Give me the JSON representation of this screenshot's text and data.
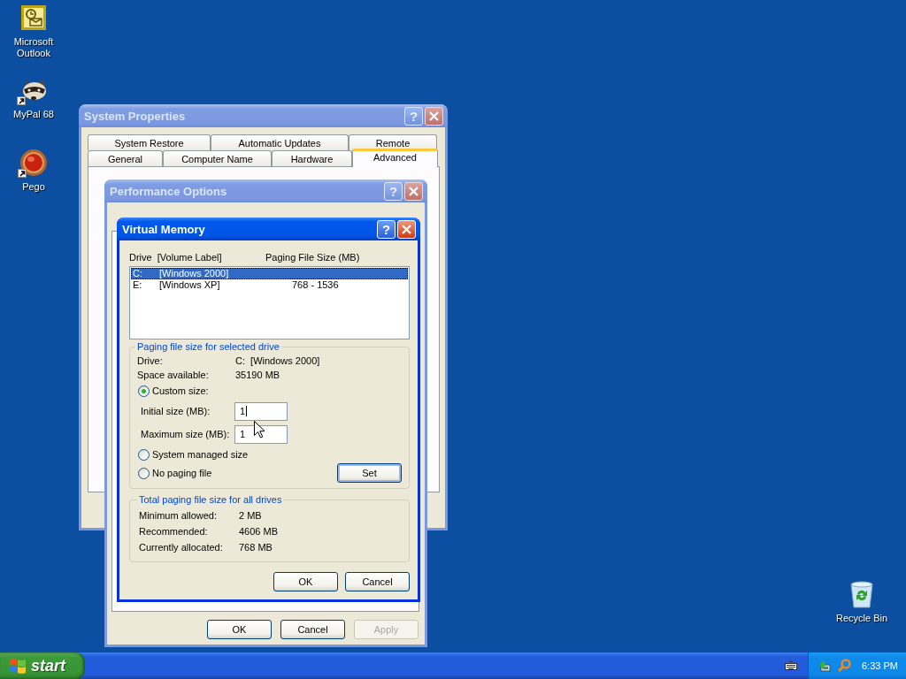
{
  "desktop_icons": [
    {
      "kind": "outlook",
      "label": "Microsoft Outlook",
      "shortcut": false
    },
    {
      "kind": "raccoon",
      "label": "MyPal 68",
      "shortcut": true
    },
    {
      "kind": "pego",
      "label": "Pego",
      "shortcut": true
    },
    {
      "kind": "recycle",
      "label": "Recycle Bin",
      "shortcut": false
    }
  ],
  "system_properties": {
    "title": "System Properties",
    "help": "?",
    "active": false,
    "tab_rows": [
      [
        {
          "label": "System Restore",
          "selected": false
        },
        {
          "label": "Automatic Updates",
          "selected": false
        },
        {
          "label": "Remote",
          "selected": false
        }
      ],
      [
        {
          "label": "General",
          "selected": false
        },
        {
          "label": "Computer Name",
          "selected": false
        },
        {
          "label": "Hardware",
          "selected": false
        },
        {
          "label": "Advanced",
          "selected": true
        }
      ]
    ]
  },
  "performance_options": {
    "title": "Performance Options",
    "help": "?",
    "active": false,
    "buttons": [
      {
        "label": "OK",
        "disabled": false
      },
      {
        "label": "Cancel",
        "disabled": false
      },
      {
        "label": "Apply",
        "disabled": true
      }
    ]
  },
  "virtual_memory": {
    "title": "Virtual Memory",
    "help": "?",
    "active": true,
    "list_columns": [
      "Drive  [Volume Label]",
      "Paging File Size (MB)"
    ],
    "drives": [
      {
        "drive": "C:",
        "label": "[Windows 2000]",
        "selected": true
      },
      {
        "drive": "E:",
        "label": "[Windows XP]",
        "size": "768 - 1536",
        "selected": false
      }
    ],
    "selected_drive": {
      "title": "Paging file size for selected drive",
      "info": [
        {
          "label": "Drive:",
          "value": "C:  [Windows 2000]"
        },
        {
          "label": "Space available:",
          "value": "35190 MB"
        }
      ],
      "options": [
        {
          "label": "Custom size:",
          "selected": true
        },
        {
          "label": "System managed size",
          "selected": false
        },
        {
          "label": "No paging file",
          "selected": false
        }
      ],
      "fields": [
        {
          "label": "Initial size (MB):",
          "value": "1",
          "focused": true
        },
        {
          "label": "Maximum size (MB):",
          "value": "1",
          "focused": false
        }
      ],
      "set_button": "Set"
    },
    "totals": {
      "title": "Total paging file size for all drives",
      "rows": [
        {
          "label": "Minimum allowed:",
          "value": "2 MB"
        },
        {
          "label": "Recommended:",
          "value": "4606 MB"
        },
        {
          "label": "Currently allocated:",
          "value": "768 MB"
        }
      ]
    },
    "buttons": [
      {
        "label": "OK"
      },
      {
        "label": "Cancel"
      }
    ]
  },
  "taskbar": {
    "start": "start",
    "clock": "6:33 PM"
  }
}
